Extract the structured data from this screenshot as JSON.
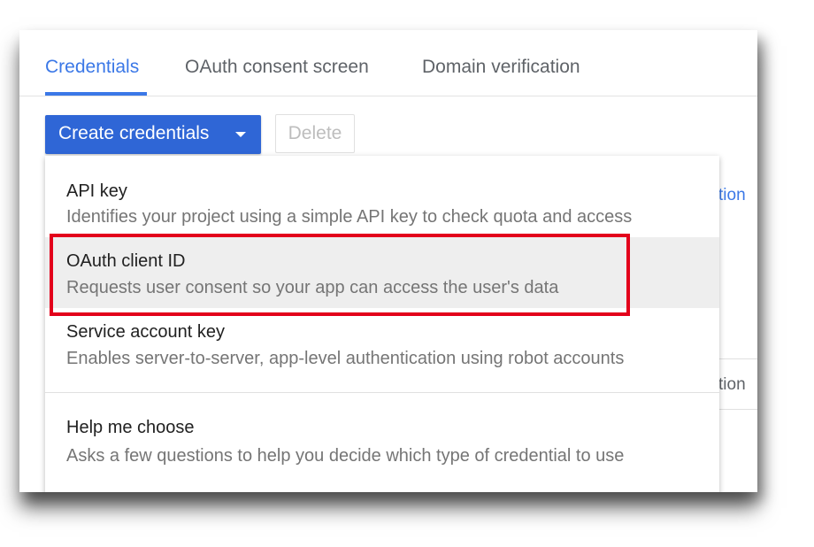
{
  "tabs": [
    {
      "label": "Credentials",
      "active": true
    },
    {
      "label": "OAuth consent screen",
      "active": false
    },
    {
      "label": "Domain verification",
      "active": false
    }
  ],
  "toolbar": {
    "create_label": "Create credentials",
    "delete_label": "Delete"
  },
  "background": {
    "partial_text_1": "tion",
    "partial_text_2": "tion"
  },
  "menu": {
    "items": [
      {
        "title": "API key",
        "description": "Identifies your project using a simple API key to check quota and access"
      },
      {
        "title": "OAuth client ID",
        "description": "Requests user consent so your app can access the user's data"
      },
      {
        "title": "Service account key",
        "description": "Enables server-to-server, app-level authentication using robot accounts"
      },
      {
        "title": "Help me choose",
        "description": "Asks a few questions to help you decide which type of credential to use"
      }
    ]
  },
  "colors": {
    "accent": "#3b78e7",
    "primary_button": "#2f66d6",
    "highlight_box": "#e3001b",
    "hover_background": "#eeeeee"
  },
  "icons": {
    "dropdown": "caret-down-icon"
  }
}
